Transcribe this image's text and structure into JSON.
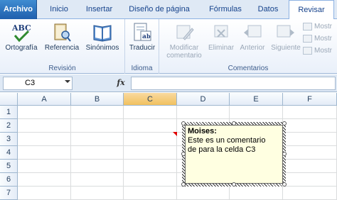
{
  "tabs": [
    {
      "label": "Archivo"
    },
    {
      "label": "Inicio"
    },
    {
      "label": "Insertar"
    },
    {
      "label": "Diseño de página"
    },
    {
      "label": "Fórmulas"
    },
    {
      "label": "Datos"
    },
    {
      "label": "Revisar",
      "active": true
    }
  ],
  "ribbon": {
    "revision": {
      "label": "Revisión",
      "buttons": [
        {
          "label": "Ortografía",
          "icon": "spelling-abc-icon"
        },
        {
          "label": "Referencia",
          "icon": "research-book-icon"
        },
        {
          "label": "Sinónimos",
          "icon": "thesaurus-book-icon"
        }
      ]
    },
    "idioma": {
      "label": "Idioma",
      "buttons": [
        {
          "label": "Traducir",
          "icon": "translate-icon"
        }
      ]
    },
    "comentarios": {
      "label": "Comentarios",
      "buttons": [
        {
          "label_line1": "Modificar",
          "label_line2": "comentario",
          "icon": "edit-comment-icon",
          "disabled": true
        },
        {
          "label": "Eliminar",
          "icon": "delete-comment-icon",
          "disabled": true
        },
        {
          "label": "Anterior",
          "icon": "previous-comment-icon",
          "disabled": true
        },
        {
          "label": "Siguiente",
          "icon": "next-comment-icon",
          "disabled": true
        }
      ],
      "small_buttons": [
        {
          "label": "Mostr"
        },
        {
          "label": "Mostr"
        },
        {
          "label": "Mostr"
        }
      ]
    }
  },
  "formula_bar": {
    "name_box": "C3",
    "fx_label": "fx",
    "formula": ""
  },
  "grid": {
    "columns": [
      "A",
      "B",
      "C",
      "D",
      "E",
      "F"
    ],
    "rows": [
      "1",
      "2",
      "3",
      "4",
      "5",
      "6",
      "7"
    ],
    "selected_column": "C"
  },
  "comment": {
    "author": "Moises:",
    "line1": "Este es un comentario",
    "line2": "de para la celda C3",
    "background": "#ffffe1"
  },
  "colors": {
    "tab_active": "#ffffff",
    "file_tab": "#2a6fc0",
    "comment_indicator": "#e00000"
  }
}
